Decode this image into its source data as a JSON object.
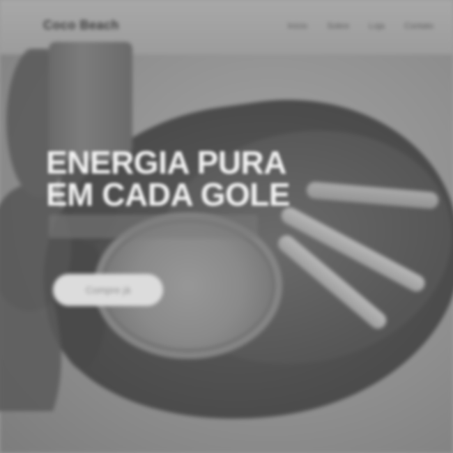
{
  "header": {
    "logo_text": "Coco Beach",
    "nav": [
      "Início",
      "Sobre",
      "Loja",
      "Contato"
    ]
  },
  "hero": {
    "title_line1": "ENERGIA PURA",
    "title_line2": "EM CADA GOLE",
    "cta_label": "Compre já"
  },
  "colors": {
    "background": "#9a9a9a",
    "title": "#f2f2f2",
    "cta_bg": "#dcdcdc"
  }
}
